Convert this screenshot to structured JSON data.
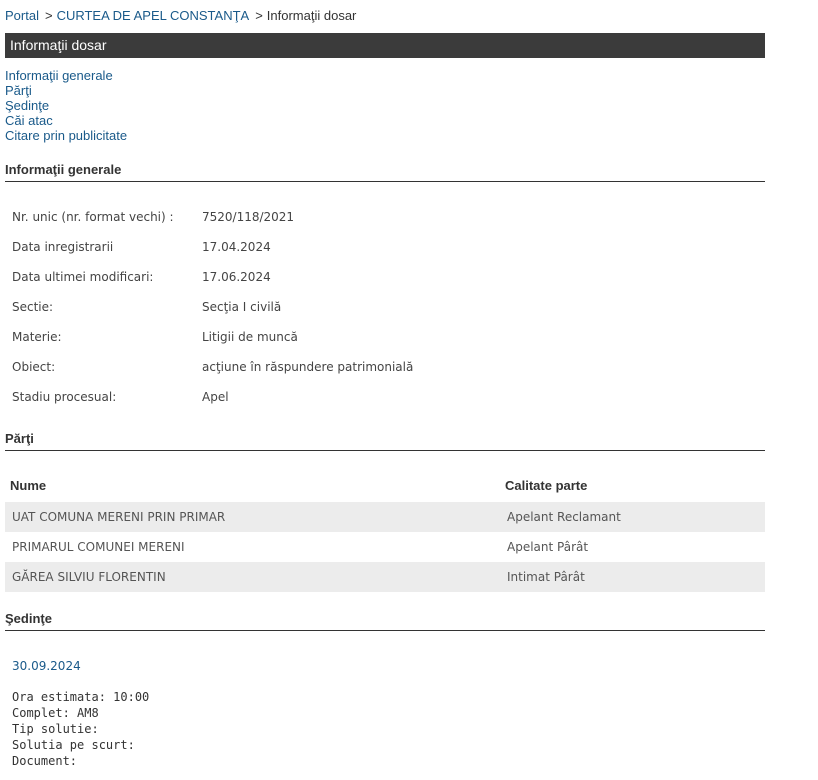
{
  "breadcrumb": {
    "portal": "Portal",
    "sep1": ">",
    "court": "CURTEA DE APEL CONSTANŢA",
    "sep2": ">",
    "current": "Informaţii dosar"
  },
  "title": "Informaţii dosar",
  "toc": [
    "Informaţii generale",
    "Părţi",
    "Şedinţe",
    "Căi atac",
    "Citare prin publicitate"
  ],
  "general": {
    "heading": "Informaţii generale",
    "rows": [
      {
        "label": "Nr. unic (nr. format vechi) :",
        "value": "7520/118/2021"
      },
      {
        "label": "Data inregistrarii",
        "value": "17.04.2024"
      },
      {
        "label": "Data ultimei modificari:",
        "value": "17.06.2024"
      },
      {
        "label": "Sectie:",
        "value": "Secţia I civilă"
      },
      {
        "label": "Materie:",
        "value": "Litigii de muncă"
      },
      {
        "label": "Obiect:",
        "value": "acţiune în răspundere patrimonială"
      },
      {
        "label": "Stadiu procesual:",
        "value": "Apel"
      }
    ]
  },
  "parti": {
    "heading": "Părţi",
    "columns": [
      "Nume",
      "Calitate parte"
    ],
    "rows": [
      {
        "nume": "UAT COMUNA MERENI PRIN PRIMAR",
        "calitate": "Apelant Reclamant"
      },
      {
        "nume": "PRIMARUL COMUNEI MERENI",
        "calitate": "Apelant Pârât"
      },
      {
        "nume": "GĂREA SILVIU FLORENTIN",
        "calitate": "Intimat Pârât"
      }
    ]
  },
  "sedinte": {
    "heading": "Şedinţe",
    "date": "30.09.2024",
    "details": [
      "Ora estimata: 10:00",
      "Complet: AM8",
      "Tip solutie:",
      "Solutia pe scurt:",
      "Document:"
    ]
  }
}
